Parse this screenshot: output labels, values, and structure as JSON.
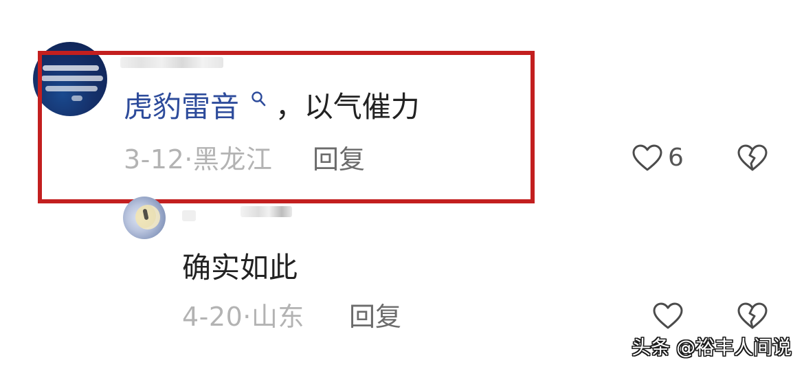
{
  "comments": [
    {
      "mention": "虎豹雷音",
      "body": "，以气催力",
      "date": "3-12",
      "location": "黑龙江",
      "reply_label": "回复",
      "likes": "6"
    },
    {
      "body": "确实如此",
      "date": "4-20",
      "location": "山东",
      "reply_label": "回复",
      "likes": ""
    }
  ],
  "meta_separator": "·",
  "watermark": "头条 @裕丰人间说",
  "colors": {
    "highlight": "#c31f1f",
    "mention": "#2d4b9b",
    "meta": "#b3b3b3",
    "body": "#222222",
    "reply": "#6b6b6b",
    "icon": "#4b4b4b"
  },
  "icons": {
    "mention_icon": "search-icon",
    "like_icon": "heart-outline-icon",
    "dislike_icon": "broken-heart-outline-icon"
  }
}
